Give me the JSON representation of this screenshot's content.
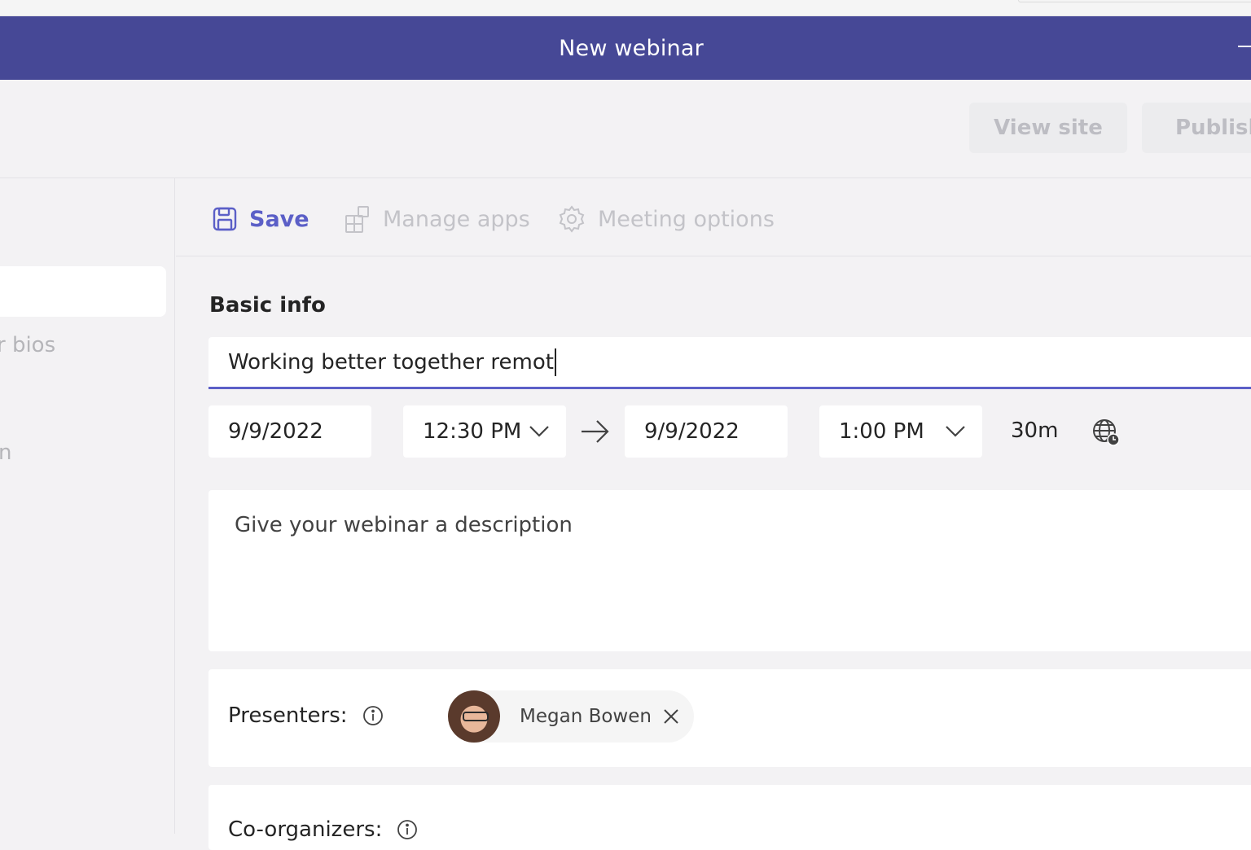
{
  "window": {
    "title": "New webinar"
  },
  "topbar": {
    "view_site_label": "View site",
    "publish_label": "Publish"
  },
  "sidebar": {
    "fragments": [
      "r bios",
      "n"
    ]
  },
  "toolbar": {
    "save_label": "Save",
    "manage_apps_label": "Manage apps",
    "meeting_options_label": "Meeting options",
    "icons": [
      "save-icon",
      "apps-icon",
      "gear-icon"
    ]
  },
  "basic_info": {
    "heading": "Basic info",
    "title_value": "Working better together remot",
    "start_date": "9/9/2022",
    "start_time": "12:30 PM",
    "end_date": "9/9/2022",
    "end_time": "1:00 PM",
    "duration": "30m",
    "description_placeholder": "Give your webinar a description"
  },
  "presenters": {
    "label": "Presenters:",
    "people": [
      {
        "name": "Megan Bowen"
      }
    ]
  },
  "coorganizers": {
    "label": "Co-organizers:"
  },
  "colors": {
    "accent": "#5b5fc7",
    "titlebar": "#464896",
    "background": "#f3f2f4"
  }
}
